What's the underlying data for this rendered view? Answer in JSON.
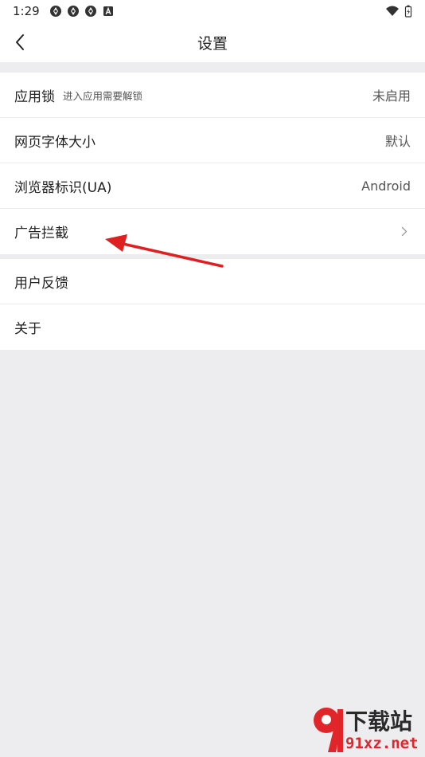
{
  "status_bar": {
    "time": "1:29",
    "icons": [
      "aperture-icon",
      "aperture-icon",
      "aperture-icon",
      "font-a-icon"
    ],
    "right_icons": [
      "wifi-icon",
      "battery-charging-icon"
    ]
  },
  "header": {
    "title": "设置",
    "back_icon": "chevron-left-icon"
  },
  "settings": {
    "group1": [
      {
        "label": "应用锁",
        "hint": "进入应用需要解锁",
        "value": "未启用"
      },
      {
        "label": "网页字体大小",
        "value": "默认"
      },
      {
        "label": "浏览器标识(UA)",
        "value": "Android"
      },
      {
        "label": "广告拦截",
        "icon": "chevron-right-icon"
      }
    ],
    "group2": [
      {
        "label": "用户反馈"
      },
      {
        "label": "关于"
      }
    ]
  },
  "annotation": {
    "color": "#e02020",
    "icon": "red-arrow-icon"
  },
  "watermark": {
    "word": "下载站",
    "domain": "91xz.net",
    "brand_color": "#e0262b"
  },
  "colors": {
    "background": "#ededf0",
    "card": "#ffffff",
    "text": "#222222",
    "secondary_text": "#555555"
  }
}
